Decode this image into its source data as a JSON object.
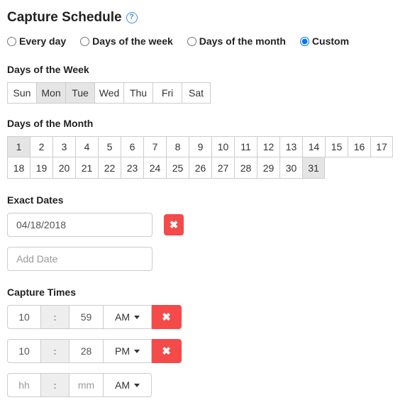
{
  "header": {
    "title": "Capture Schedule"
  },
  "recurrence": {
    "options": [
      {
        "label": "Every day",
        "value": "every"
      },
      {
        "label": "Days of the week",
        "value": "dow"
      },
      {
        "label": "Days of the month",
        "value": "dom"
      },
      {
        "label": "Custom",
        "value": "custom"
      }
    ],
    "selected": "custom"
  },
  "dow": {
    "label": "Days of the Week",
    "items": [
      {
        "label": "Sun",
        "selected": false
      },
      {
        "label": "Mon",
        "selected": true
      },
      {
        "label": "Tue",
        "selected": true
      },
      {
        "label": "Wed",
        "selected": false
      },
      {
        "label": "Thu",
        "selected": false
      },
      {
        "label": "Fri",
        "selected": false
      },
      {
        "label": "Sat",
        "selected": false
      }
    ]
  },
  "dom": {
    "label": "Days of the Month",
    "selected": [
      1,
      31
    ]
  },
  "exact_dates": {
    "label": "Exact Dates",
    "items": [
      {
        "value": "04/18/2018"
      }
    ],
    "add_placeholder": "Add Date"
  },
  "capture_times": {
    "label": "Capture Times",
    "rows": [
      {
        "hh": "10",
        "mm": "59",
        "ampm": "AM",
        "removable": true
      },
      {
        "hh": "10",
        "mm": "28",
        "ampm": "PM",
        "removable": true
      },
      {
        "hh": "",
        "mm": "",
        "ampm": "AM",
        "removable": false
      }
    ],
    "hh_placeholder": "hh",
    "mm_placeholder": "mm"
  },
  "colors": {
    "danger": "#f44a4a",
    "accent": "#3f8fe0"
  }
}
